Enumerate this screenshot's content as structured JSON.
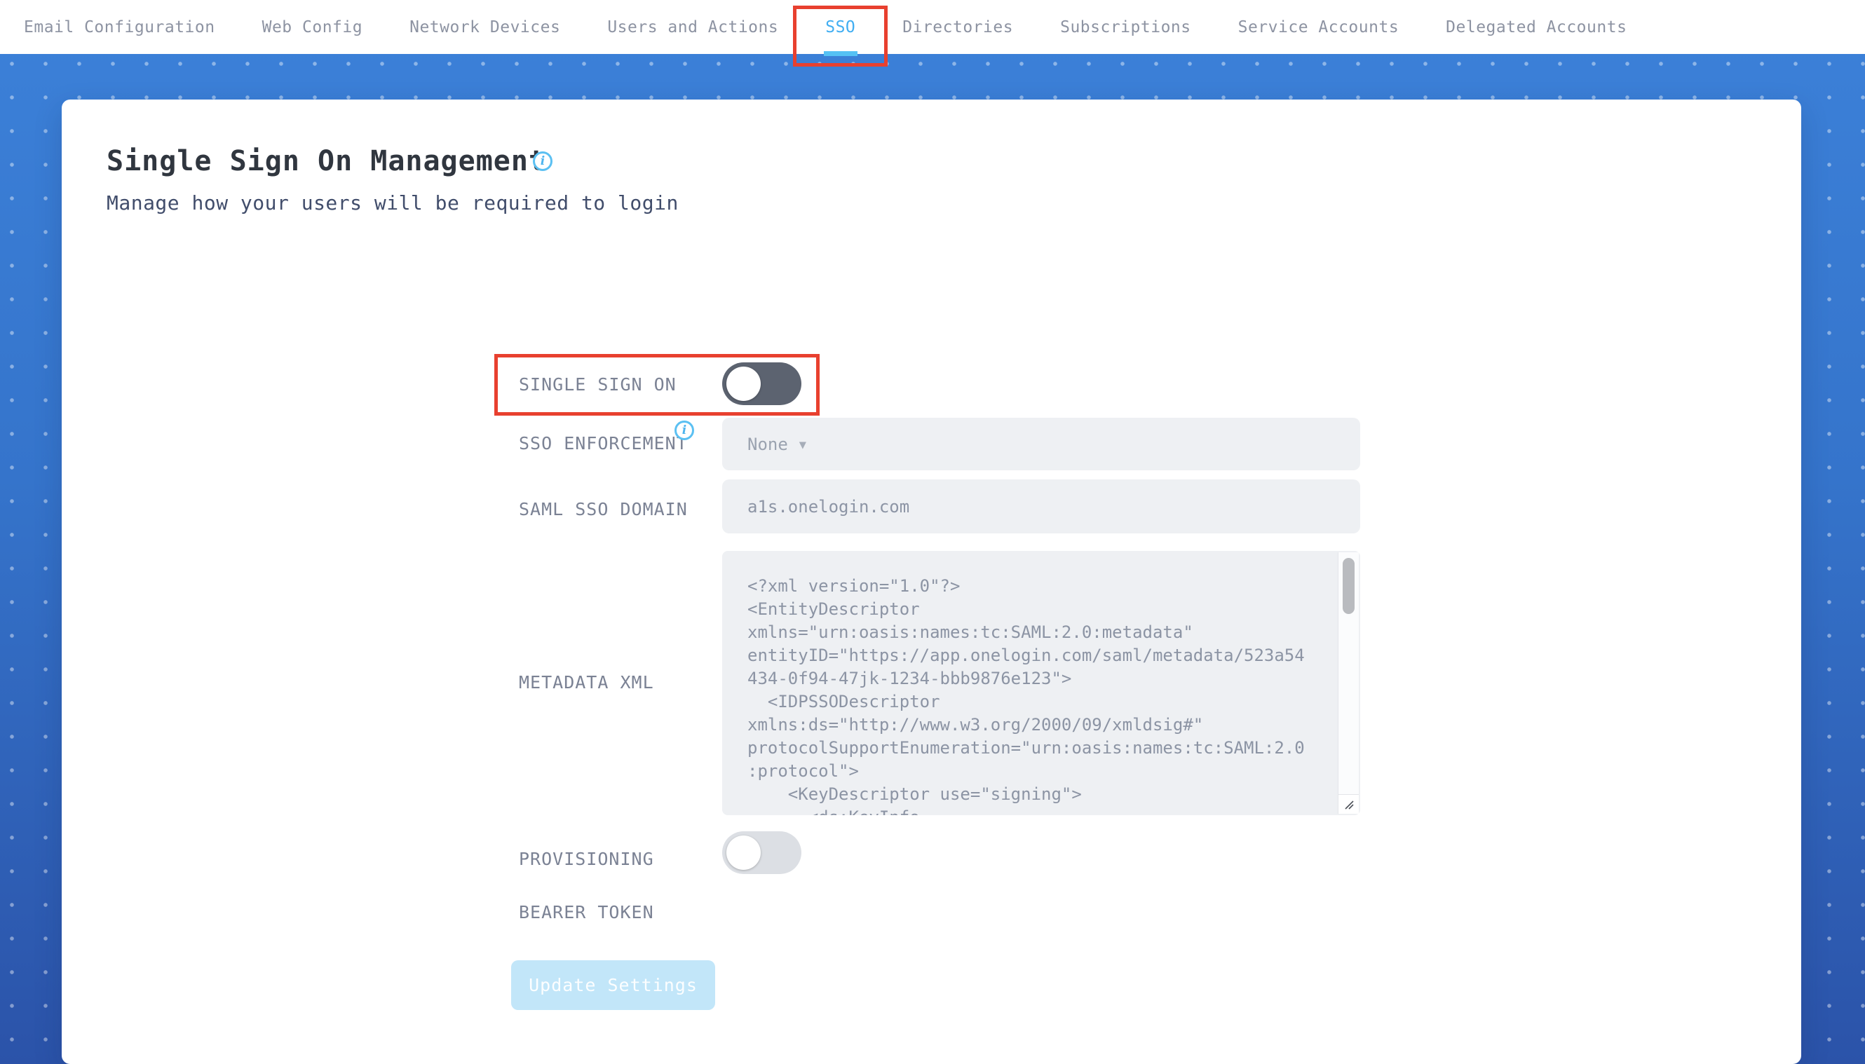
{
  "nav": {
    "tabs": [
      {
        "label": "Email Configuration",
        "active": false
      },
      {
        "label": "Web Config",
        "active": false
      },
      {
        "label": "Network Devices",
        "active": false
      },
      {
        "label": "Users and Actions",
        "active": false
      },
      {
        "label": "SSO",
        "active": true
      },
      {
        "label": "Directories",
        "active": false
      },
      {
        "label": "Subscriptions",
        "active": false
      },
      {
        "label": "Service Accounts",
        "active": false
      },
      {
        "label": "Delegated Accounts",
        "active": false
      }
    ]
  },
  "page": {
    "title": "Single Sign On Management",
    "subtitle": "Manage how your users will be required to login"
  },
  "icons": {
    "info": "i",
    "dropdown_caret": "▼"
  },
  "form": {
    "single_sign_on": {
      "label": "SINGLE SIGN ON",
      "enabled": false
    },
    "sso_enforcement": {
      "label": "SSO ENFORCEMENT",
      "value": "None"
    },
    "saml_sso_domain": {
      "label": "SAML SSO DOMAIN",
      "value": "a1s.onelogin.com"
    },
    "metadata_xml": {
      "label": "METADATA XML",
      "value": "<?xml version=\"1.0\"?>\n<EntityDescriptor\nxmlns=\"urn:oasis:names:tc:SAML:2.0:metadata\"\nentityID=\"https://app.onelogin.com/saml/metadata/523a54\n434-0f94-47jk-1234-bbb9876e123\">\n  <IDPSSODescriptor\nxmlns:ds=\"http://www.w3.org/2000/09/xmldsig#\"\nprotocolSupportEnumeration=\"urn:oasis:names:tc:SAML:2.0\n:protocol\">\n    <KeyDescriptor use=\"signing\">\n      <ds:KeyInfo"
    },
    "provisioning": {
      "label": "PROVISIONING",
      "enabled": false
    },
    "bearer_token": {
      "label": "BEARER TOKEN"
    },
    "submit_label": "Update Settings"
  },
  "colors": {
    "accent_blue": "#41aef2",
    "tab_underline": "#55c1f4",
    "annotation_red": "#e8402f",
    "background_top": "#3c81d9",
    "background_bottom": "#2b53a9",
    "toggle_on_track": "#5c6370",
    "toggle_off_track": "#dcdfe4",
    "field_background": "#eef0f3",
    "button_background": "#c2e6f9",
    "info_icon_blue": "#5bc0f2"
  }
}
